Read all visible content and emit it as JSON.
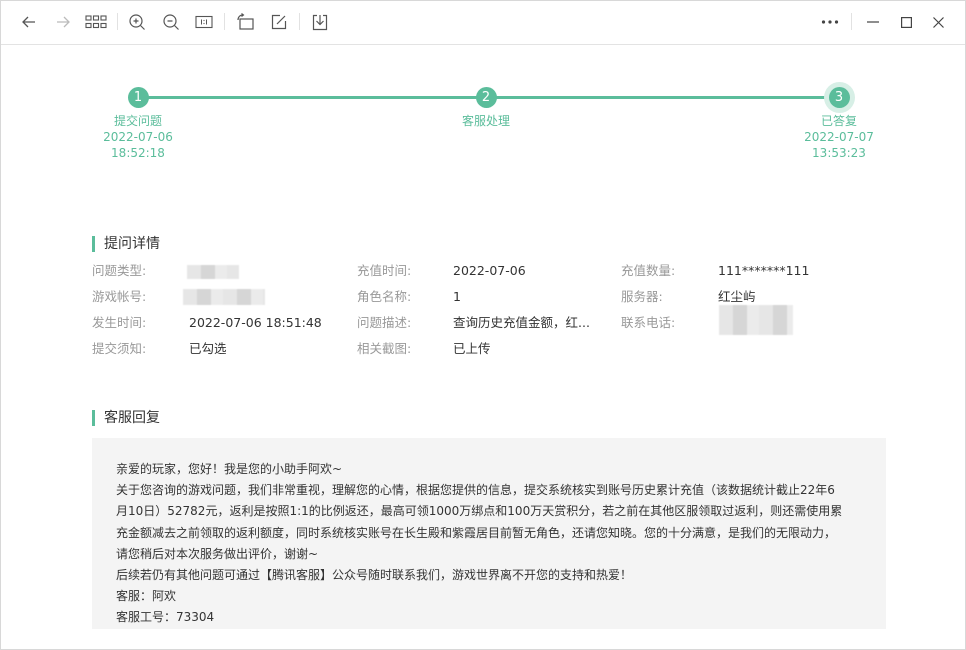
{
  "toolbar": {
    "left_icons": [
      "back-icon",
      "forward-icon",
      "grid-icon",
      "zoom-in-icon",
      "zoom-out-icon",
      "actual-size-icon",
      "rotate-icon",
      "edit-icon",
      "download-icon"
    ],
    "right_icons": [
      "more-icon",
      "minimize-icon",
      "maximize-icon",
      "close-icon"
    ]
  },
  "progress": {
    "accent_color": "#5bbd9b",
    "steps": [
      {
        "number": "1",
        "title": "提交问题",
        "date": "2022-07-06",
        "time": "18:52:18"
      },
      {
        "number": "2",
        "title": "客服处理",
        "date": "",
        "time": ""
      },
      {
        "number": "3",
        "title": "已答复",
        "date": "2022-07-07",
        "time": "13:53:23"
      }
    ]
  },
  "details": {
    "title": "提问详情",
    "rows": [
      [
        {
          "label": "问题类型:",
          "value": "",
          "blurred": true
        },
        {
          "label": "充值时间:",
          "value": "2022-07-06"
        },
        {
          "label": "充值数量:",
          "value": "111*******111"
        }
      ],
      [
        {
          "label": "游戏帐号:",
          "value": "",
          "blurred": true
        },
        {
          "label": "角色名称:",
          "value": "1"
        },
        {
          "label": "服务器:",
          "value": "红尘屿"
        }
      ],
      [
        {
          "label": "发生时间:",
          "value": "2022-07-06 18:51:48"
        },
        {
          "label": "问题描述:",
          "value": "查询历史充值金额，红..."
        },
        {
          "label": "联系电话:",
          "value": "",
          "blurred": true
        }
      ],
      [
        {
          "label": "提交须知:",
          "value": "已勾选"
        },
        {
          "label": "相关截图:",
          "value": "已上传"
        }
      ]
    ]
  },
  "reply": {
    "title": "客服回复",
    "lines": [
      "亲爱的玩家，您好！我是您的小助手阿欢~",
      "关于您咨询的游戏问题，我们非常重视，理解您的心情，根据您提供的信息，提交系统核实到账号历史累计充值（该数据统计截止22年6",
      "月10日）52782元，返利是按照1:1的比例返还，最高可领1000万绑点和100万天赏积分，若之前在其他区服领取过返利，则还需使用累",
      "充金额减去之前领取的返利额度，同时系统核实账号在长生殿和紫霞居目前暂无角色，还请您知晓。您的十分满意，是我们的无限动力，",
      "请您稍后对本次服务做出评价，谢谢~",
      "后续若仍有其他问题可通过【腾讯客服】公众号随时联系我们，游戏世界离不开您的支持和热爱！",
      "客服：阿欢",
      "客服工号：73304"
    ]
  }
}
